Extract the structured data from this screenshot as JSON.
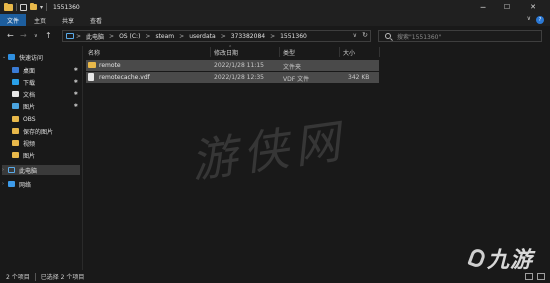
{
  "window": {
    "title": "1551360",
    "controls": {
      "minimize": "─",
      "maximize": "☐",
      "close": "✕"
    }
  },
  "ribbon": {
    "tabs": [
      "文件",
      "主页",
      "共享",
      "查看"
    ],
    "help": "?",
    "expand": "∨"
  },
  "nav": {
    "back": "←",
    "forward": "→",
    "recent": "∨",
    "up": "↑",
    "breadcrumb": [
      "此电脑",
      "OS (C:)",
      "steam",
      "userdata",
      "373382084",
      "1551360"
    ],
    "separator": ">",
    "dropdown": "∨",
    "refresh": "↻",
    "search_placeholder": "搜索\"1551360\""
  },
  "sidebar": {
    "quick_access": "快速访问",
    "items": [
      {
        "label": "桌面",
        "icon": "desktop-icon",
        "pinned": true
      },
      {
        "label": "下载",
        "icon": "download-icon",
        "pinned": true
      },
      {
        "label": "文档",
        "icon": "document-icon",
        "pinned": true
      },
      {
        "label": "图片",
        "icon": "pictures-icon",
        "pinned": true
      },
      {
        "label": "OBS",
        "icon": "folder-icon",
        "pinned": false
      },
      {
        "label": "保存的图片",
        "icon": "folder-icon",
        "pinned": false
      },
      {
        "label": "视频",
        "icon": "folder-icon",
        "pinned": false
      },
      {
        "label": "图片",
        "icon": "folder-icon",
        "pinned": false
      }
    ],
    "this_pc": "此电脑",
    "network": "网络",
    "pin_glyph": "✱"
  },
  "columns": [
    "名称",
    "修改日期",
    "类型",
    "大小"
  ],
  "files": [
    {
      "name": "remote",
      "modified": "2022/1/28 11:15",
      "type": "文件夹",
      "size": "",
      "icon": "folder-icon"
    },
    {
      "name": "remotecache.vdf",
      "modified": "2022/1/28 12:35",
      "type": "VDF 文件",
      "size": "342 KB",
      "icon": "file-icon"
    }
  ],
  "status": {
    "item_count": "2 个项目",
    "selected": "已选择 2 个项目"
  },
  "overlay": {
    "watermark": "游侠网",
    "logo_text": "九游"
  },
  "colors": {
    "background": "#191919",
    "titlebar": "#202020",
    "selection": "#4a4a4a",
    "accent": "#2b79d6",
    "folder": "#e8b84a"
  }
}
